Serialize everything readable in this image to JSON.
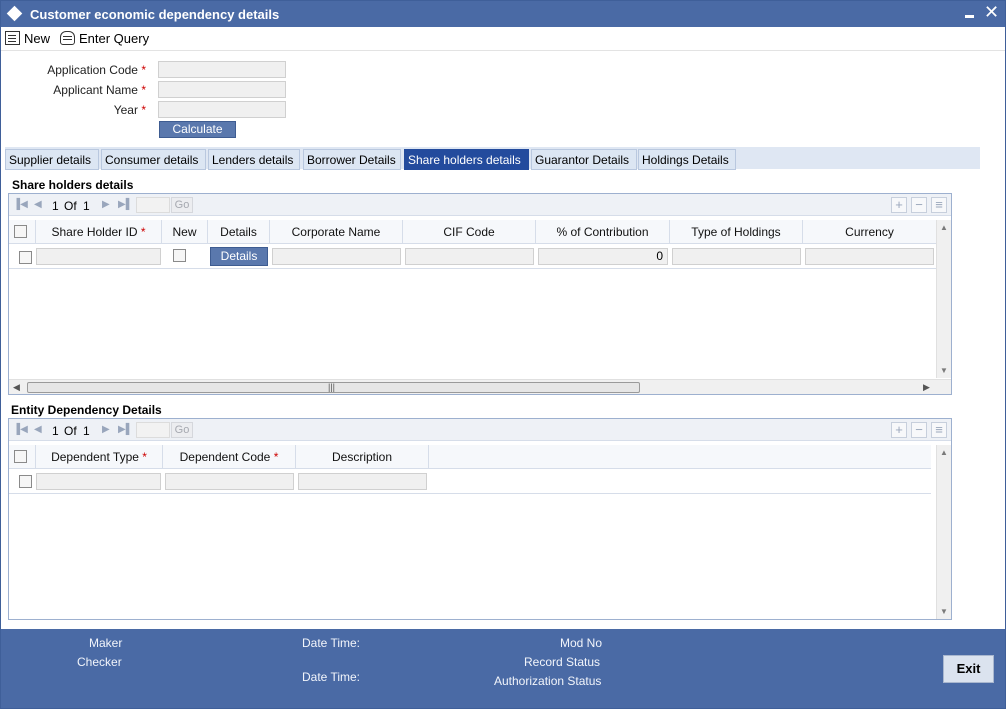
{
  "window": {
    "title": "Customer economic dependency details",
    "minimize_icon": "minimize-icon",
    "close_icon": "close-icon",
    "close_glyph": "✕"
  },
  "toolbar": {
    "new_label": "New",
    "enter_query_label": "Enter Query"
  },
  "form": {
    "application_code_label": "Application Code",
    "applicant_name_label": "Applicant Name",
    "year_label": "Year",
    "required_mark": "*",
    "application_code_value": "",
    "applicant_name_value": "",
    "year_value": "",
    "calculate_label": "Calculate"
  },
  "tabs": [
    {
      "label": "Supplier details"
    },
    {
      "label": "Consumer details"
    },
    {
      "label": "Lenders details"
    },
    {
      "label": "Borrower Details"
    },
    {
      "label": "Share holders details",
      "active": true
    },
    {
      "label": "Guarantor Details"
    },
    {
      "label": "Holdings Details"
    }
  ],
  "share_holders": {
    "section_title": "Share holders details",
    "pager": {
      "current": "1",
      "of_label": "Of",
      "total": "1",
      "go_label": "Go"
    },
    "columns": [
      "Share Holder ID",
      "New",
      "Details",
      "Corporate Name",
      "CIF Code",
      "% of Contribution",
      "Type of Holdings",
      "Currency"
    ],
    "row": {
      "share_holder_id": "",
      "details_button_label": "Details",
      "corporate_name": "",
      "cif_code": "",
      "contribution": "0",
      "type_of_holdings": "",
      "currency": ""
    }
  },
  "entity_dependency": {
    "section_title": "Entity Dependency Details",
    "pager": {
      "current": "1",
      "of_label": "Of",
      "total": "1",
      "go_label": "Go"
    },
    "columns": [
      "Dependent Type",
      "Dependent Code",
      "Description"
    ],
    "row": {
      "dependent_type": "",
      "dependent_code": "",
      "description": ""
    }
  },
  "footer": {
    "maker_label": "Maker",
    "checker_label": "Checker",
    "date_time_label_1": "Date Time:",
    "date_time_label_2": "Date Time:",
    "mod_no_label": "Mod No",
    "record_status_label": "Record Status",
    "authorization_status_label": "Authorization Status",
    "exit_label": "Exit"
  },
  "colors": {
    "title_bar": "#4a6aa5",
    "active_tab": "#234b9d",
    "button": "#5a78ad",
    "required": "#cc0000"
  }
}
